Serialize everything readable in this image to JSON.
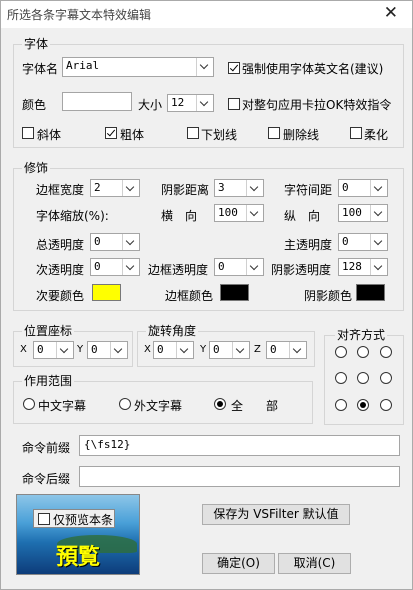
{
  "window": {
    "title": "所选各条字幕文本特效编辑",
    "close": "✕"
  },
  "font": {
    "group": "字体",
    "name_label": "字体名",
    "name_value": "Arial",
    "force_english": "强制使用字体英文名(建议)",
    "color_label": "颜色",
    "size_label": "大小",
    "size_value": "12",
    "karaoke_label": "对整句应用卡拉OK特效指令",
    "italic": "斜体",
    "bold": "粗体",
    "underline": "下划线",
    "strikeout": "删除线",
    "soft": "柔化"
  },
  "decor": {
    "group": "修饰",
    "border_width_label": "边框宽度",
    "border_width": "2",
    "shadow_dist_label": "阴影距离",
    "shadow_dist": "3",
    "spacing_label": "字符间距",
    "spacing": "0",
    "scale_label": "字体缩放(%):",
    "horiz_label": "横　向",
    "horiz": "100",
    "vert_label": "纵　向",
    "vert": "100",
    "total_alpha_label": "总透明度",
    "total_alpha": "0",
    "primary_alpha_label": "主透明度",
    "primary_alpha": "0",
    "secondary_alpha_label": "次透明度",
    "secondary_alpha": "0",
    "border_alpha_label": "边框透明度",
    "border_alpha": "0",
    "shadow_alpha_label": "阴影透明度",
    "shadow_alpha": "128",
    "secondary_color_label": "次要颜色",
    "border_color_label": "边框颜色",
    "shadow_color_label": "阴影颜色"
  },
  "colors": {
    "primary": "#ffffff",
    "secondary": "#ffff00",
    "border": "#000000",
    "shadow": "#000000"
  },
  "position": {
    "group": "位置座标",
    "x_label": "X",
    "x": "0",
    "y_label": "Y",
    "y": "0"
  },
  "rotation": {
    "group": "旋转角度",
    "x_label": "X",
    "x": "0",
    "y_label": "Y",
    "y": "0",
    "z_label": "Z",
    "z": "0"
  },
  "align": {
    "group": "对齐方式",
    "selected": 8
  },
  "scope": {
    "group": "作用范围",
    "chinese": "中文字幕",
    "foreign": "外文字幕",
    "all_a": "全",
    "all_b": "部"
  },
  "command": {
    "prefix_label": "命令前缀",
    "prefix_value": "{\\fs12}",
    "suffix_label": "命令后缀",
    "suffix_value": ""
  },
  "preview": {
    "checkbox_label": "仅预览本条",
    "text": "預覧"
  },
  "buttons": {
    "save_default": "保存为 VSFilter 默认值",
    "ok": "确定(O)",
    "cancel": "取消(C)"
  }
}
